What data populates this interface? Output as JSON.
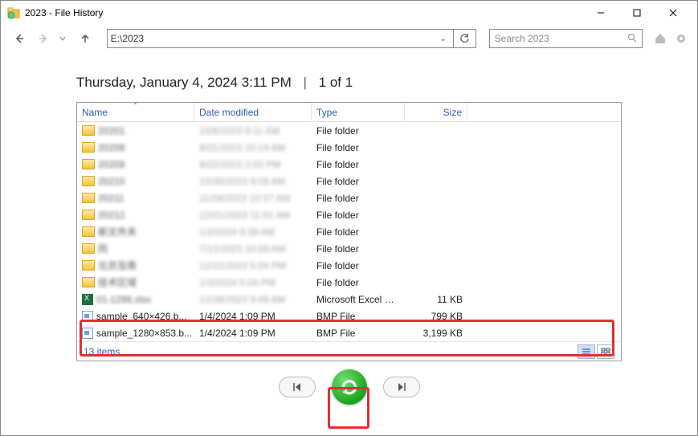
{
  "window": {
    "title": "2023 - File History"
  },
  "toolbar": {
    "path": "E:\\2023",
    "search_placeholder": "Search 2023"
  },
  "context": {
    "timestamp": "Thursday, January 4, 2024 3:11 PM",
    "position": "1 of 1"
  },
  "columns": {
    "name": "Name",
    "date": "Date modified",
    "type": "Type",
    "size": "Size"
  },
  "rows": [
    {
      "kind": "folder",
      "name": "20201",
      "date": "10/9/2023 9:11 AM",
      "type": "File folder",
      "size": "",
      "blur": true
    },
    {
      "kind": "folder",
      "name": "20208",
      "date": "9/21/2023 10:19 AM",
      "type": "File folder",
      "size": "",
      "blur": true
    },
    {
      "kind": "folder",
      "name": "20209",
      "date": "9/22/2023 2:02 PM",
      "type": "File folder",
      "size": "",
      "blur": true
    },
    {
      "kind": "folder",
      "name": "20210",
      "date": "10/30/2023 9:08 AM",
      "type": "File folder",
      "size": "",
      "blur": true
    },
    {
      "kind": "folder",
      "name": "20211",
      "date": "11/28/2023 10:37 AM",
      "type": "File folder",
      "size": "",
      "blur": true
    },
    {
      "kind": "folder",
      "name": "20212",
      "date": "12/21/2023 11:01 AM",
      "type": "File folder",
      "size": "",
      "blur": true
    },
    {
      "kind": "folder",
      "name": "新文件夹",
      "date": "1/2/2024 9:38 AM",
      "type": "File folder",
      "size": "",
      "blur": true
    },
    {
      "kind": "folder",
      "name": "同",
      "date": "7/13/2023 10:59 AM",
      "type": "File folder",
      "size": "",
      "blur": true
    },
    {
      "kind": "folder",
      "name": "北京及南",
      "date": "12/22/2023 5:04 PM",
      "type": "File folder",
      "size": "",
      "blur": true
    },
    {
      "kind": "folder",
      "name": "技术区域",
      "date": "1/3/2024 5:04 PM",
      "type": "File folder",
      "size": "",
      "blur": true
    },
    {
      "kind": "excel",
      "name": "01-1296.xlsx",
      "date": "12/26/2023 9:48 AM",
      "type": "Microsoft Excel W...",
      "size": "11 KB",
      "blur": true
    },
    {
      "kind": "bmp",
      "name": "sample_640×426.b...",
      "date": "1/4/2024 1:09 PM",
      "type": "BMP File",
      "size": "799 KB",
      "blur": false
    },
    {
      "kind": "bmp",
      "name": "sample_1280×853.b...",
      "date": "1/4/2024 1:09 PM",
      "type": "BMP File",
      "size": "3,199 KB",
      "blur": false
    }
  ],
  "status": {
    "count": "13 items"
  }
}
